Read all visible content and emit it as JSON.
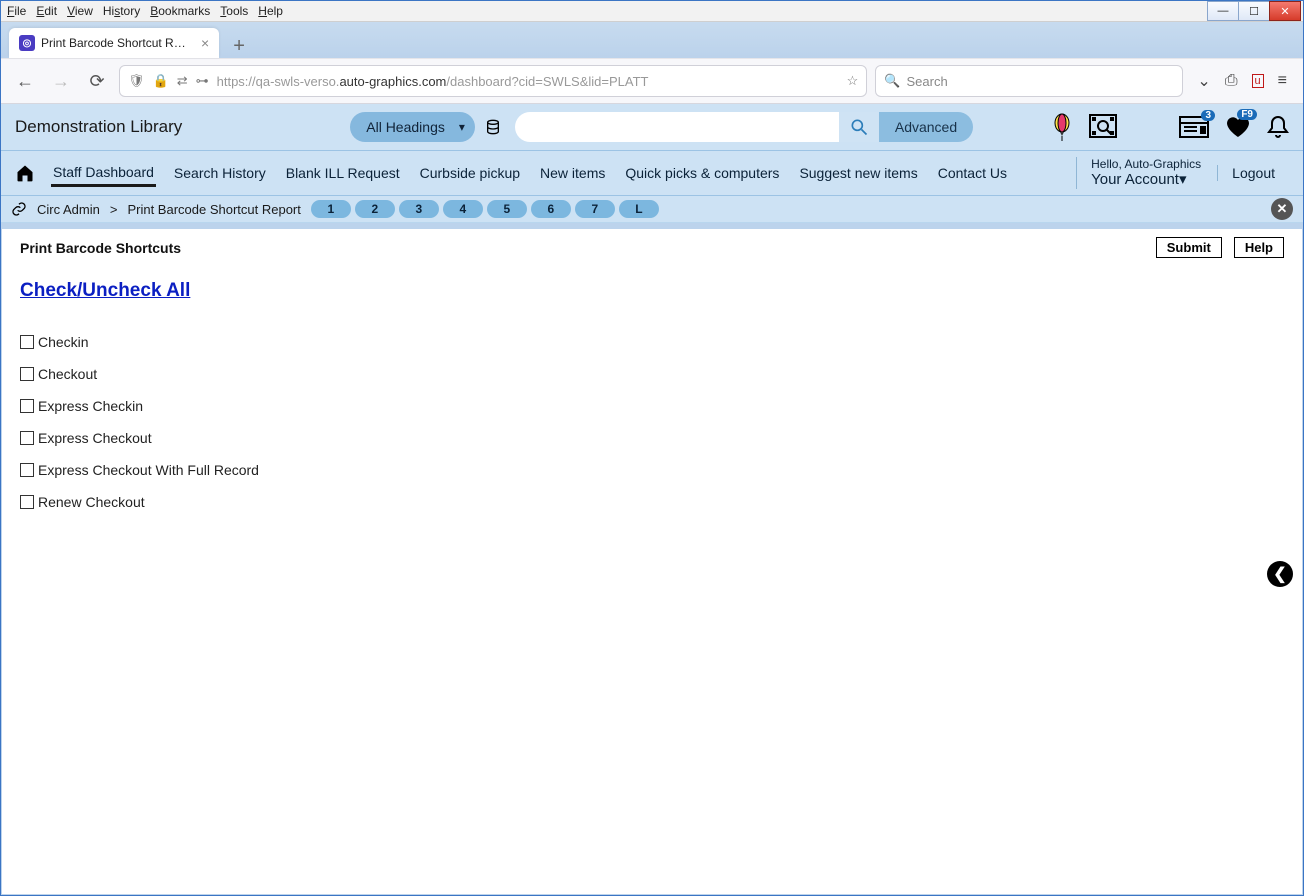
{
  "os_menu": [
    "File",
    "Edit",
    "View",
    "History",
    "Bookmarks",
    "Tools",
    "Help"
  ],
  "browser": {
    "tab_title": "Print Barcode Shortcut Report |",
    "url_prefix": "https://qa-swls-verso.",
    "url_domain": "auto-graphics.com",
    "url_path": "/dashboard?cid=SWLS&lid=PLATT",
    "search_placeholder": "Search"
  },
  "library_name": "Demonstration Library",
  "search_headings": "All Headings",
  "advanced_label": "Advanced",
  "account": {
    "greeting": "Hello, Auto-Graphics",
    "label": "Your Account",
    "logout": "Logout"
  },
  "badge_news": "3",
  "badge_fav": "F9",
  "nav_links": [
    "Staff Dashboard",
    "Search History",
    "Blank ILL Request",
    "Curbside pickup",
    "New items",
    "Quick picks & computers",
    "Suggest new items",
    "Contact Us"
  ],
  "breadcrumb": {
    "admin": "Circ Admin",
    "page": "Print Barcode Shortcut Report",
    "pages": [
      "1",
      "2",
      "3",
      "4",
      "5",
      "6",
      "7",
      "L"
    ]
  },
  "panel": {
    "heading": "Print Barcode Shortcuts",
    "submit": "Submit",
    "help": "Help",
    "check_all": "Check/Uncheck All",
    "options": [
      "Checkin",
      "Checkout",
      "Express Checkin",
      "Express Checkout",
      "Express Checkout With Full Record",
      "Renew Checkout"
    ]
  }
}
